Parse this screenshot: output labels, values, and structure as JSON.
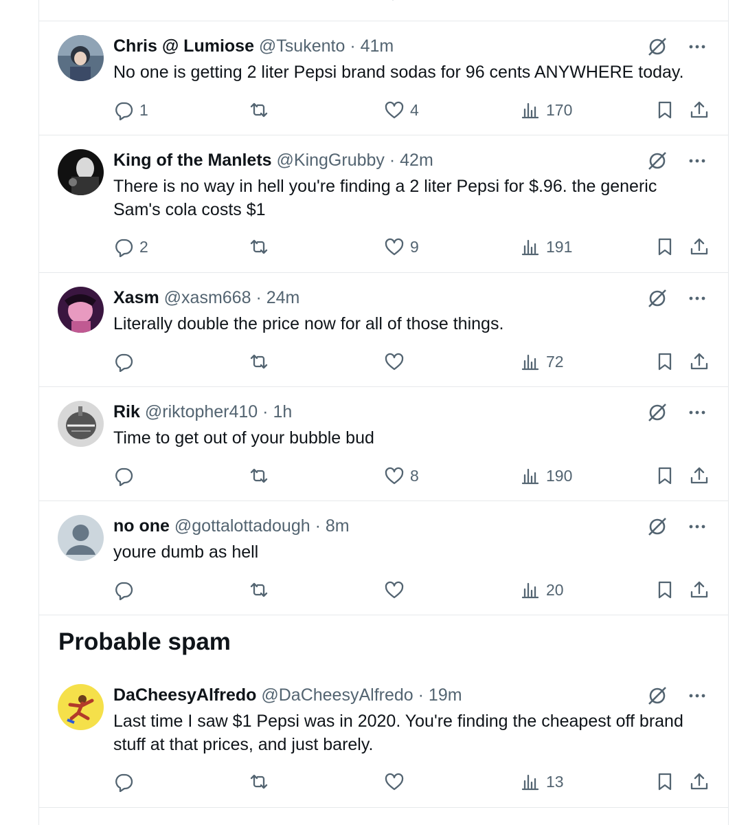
{
  "colors": {
    "text": "#0f1419",
    "secondary": "#536471",
    "border": "#e6e9eb"
  },
  "tweets": [
    {
      "name": "Chris @ Lumiose",
      "handle": "@Tsukento",
      "time": "41m",
      "text": "No one is getting 2 liter Pepsi brand sodas for 96 cents ANYWHERE today.",
      "replies": "1",
      "likes": "4",
      "views": "170"
    },
    {
      "name": "King of the Manlets",
      "handle": "@KingGrubby",
      "time": "42m",
      "text": "There is no way in hell you're finding a 2 liter Pepsi for $.96. the generic Sam's cola costs $1",
      "replies": "2",
      "likes": "9",
      "views": "191"
    },
    {
      "name": "Xasm",
      "handle": "@xasm668",
      "time": "24m",
      "text": "Literally double the price now for all of those things.",
      "replies": "",
      "likes": "",
      "views": "72"
    },
    {
      "name": "Rik",
      "handle": "@riktopher410",
      "time": "1h",
      "text": "Time to get out of your bubble bud",
      "replies": "",
      "likes": "8",
      "views": "190"
    },
    {
      "name": "no one",
      "handle": "@gottalottadough",
      "time": "8m",
      "text": "youre dumb as hell",
      "replies": "",
      "likes": "",
      "views": "20"
    }
  ],
  "section": {
    "title": "Probable spam"
  },
  "spam_tweet": {
    "name": "DaCheesyAlfredo",
    "handle": "@DaCheesyAlfredo",
    "time": "19m",
    "text": "Last time I saw $1 Pepsi was in 2020. You're finding the cheapest off brand stuff at that prices, and just barely.",
    "replies": "",
    "likes": "",
    "views": "13"
  },
  "icons": [
    "reply-icon",
    "retweet-icon",
    "like-icon",
    "views-icon",
    "bookmark-icon",
    "share-icon",
    "grok-icon",
    "more-icon"
  ]
}
